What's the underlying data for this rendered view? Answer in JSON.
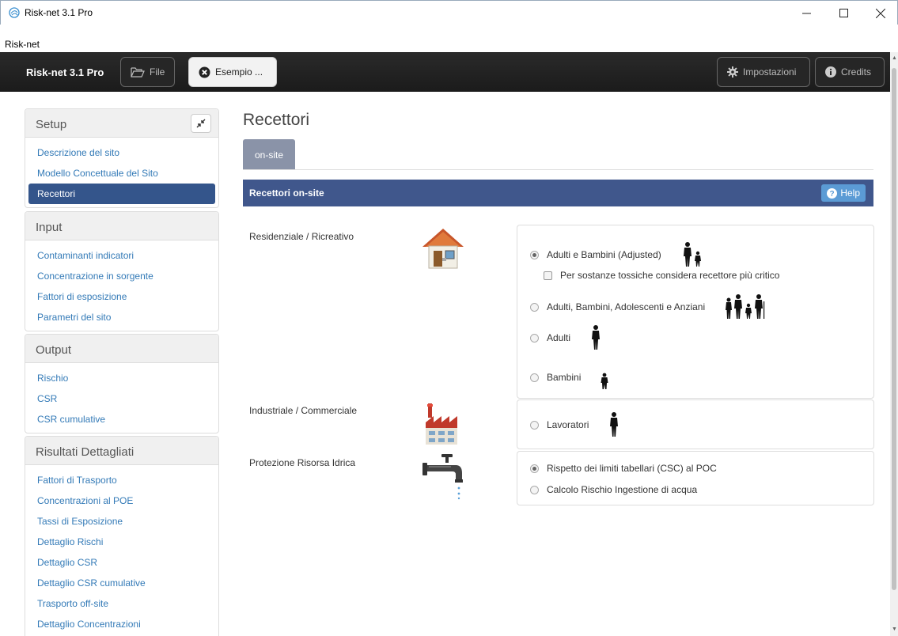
{
  "window": {
    "title": "Risk-net 3.1 Pro"
  },
  "menubar": {
    "item": "Risk-net"
  },
  "navbar": {
    "brand": "Risk-net 3.1 Pro",
    "file_label": "File",
    "example_label": "Esempio ...",
    "settings_label": "Impostazioni",
    "credits_label": "Credits"
  },
  "sidebar": {
    "setup": {
      "title": "Setup",
      "items": [
        "Descrizione del sito",
        "Modello Concettuale del Sito",
        "Recettori"
      ]
    },
    "input": {
      "title": "Input",
      "items": [
        "Contaminanti indicatori",
        "Concentrazione in sorgente",
        "Fattori di esposizione",
        "Parametri del sito"
      ]
    },
    "output": {
      "title": "Output",
      "items": [
        "Rischio",
        "CSR",
        "CSR cumulative"
      ]
    },
    "detailed": {
      "title": "Risultati Dettagliati",
      "items": [
        "Fattori di Trasporto",
        "Concentrazioni al POE",
        "Tassi di Esposizione",
        "Dettaglio Rischi",
        "Dettaglio CSR",
        "Dettaglio CSR cumulative",
        "Trasporto off-site",
        "Dettaglio Concentrazioni"
      ]
    },
    "active_item": "Recettori"
  },
  "main": {
    "title": "Recettori",
    "tab": "on-site",
    "section_title": "Recettori on-site",
    "help_label": "Help",
    "groups": {
      "residential": {
        "label": "Residenziale / Ricreativo",
        "icon": "house-icon",
        "options": [
          {
            "label": "Adulti e Bambini (Adjusted)",
            "selected": true,
            "icon": "adult-child-icon"
          },
          {
            "label": "Adulti, Bambini, Adolescenti e Anziani",
            "selected": false,
            "icon": "family-icon"
          },
          {
            "label": "Adulti",
            "selected": false,
            "icon": "adult-icon"
          },
          {
            "label": "Bambini",
            "selected": false,
            "icon": "child-icon"
          }
        ],
        "checkbox": {
          "label": "Per sostanze tossiche considera recettore più critico",
          "checked": false
        }
      },
      "industrial": {
        "label": "Industriale / Commerciale",
        "icon": "factory-icon",
        "options": [
          {
            "label": "Lavoratori",
            "selected": false,
            "icon": "worker-icon"
          }
        ]
      },
      "water": {
        "label": "Protezione Risorsa Idrica",
        "icon": "faucet-icon",
        "options": [
          {
            "label": "Rispetto dei limiti tabellari (CSC) al POC",
            "selected": true
          },
          {
            "label": "Calcolo Rischio Ingestione di acqua",
            "selected": false
          }
        ]
      }
    }
  },
  "colors": {
    "navbar": "#1f1f1f",
    "section_bar": "#40578c",
    "active_item": "#34558b",
    "tab": "#8a93a8",
    "link": "#337ab7",
    "help": "#5b9bd5"
  }
}
